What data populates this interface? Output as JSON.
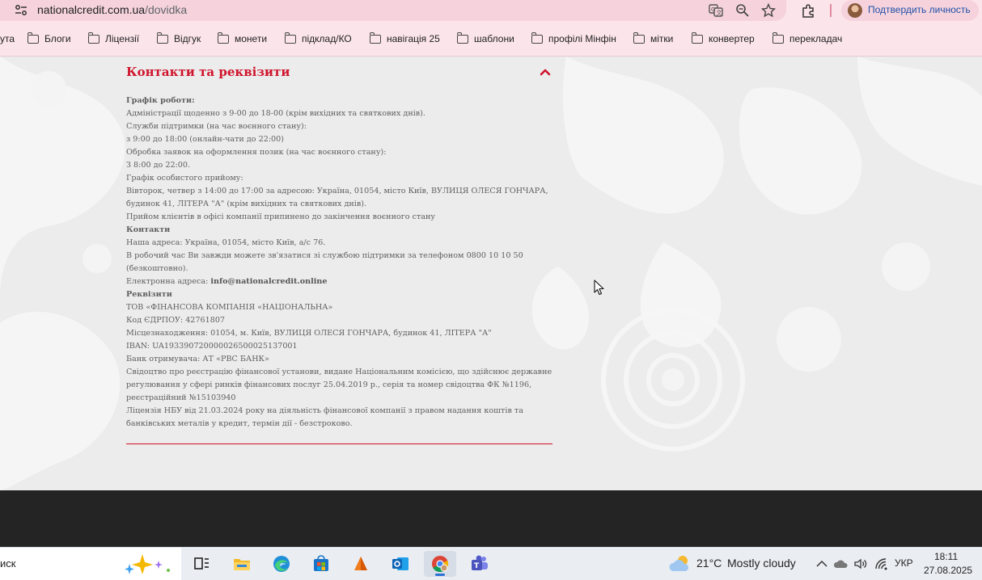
{
  "browser": {
    "url_host": "nationalcredit.com.ua",
    "url_path": "/dovidka",
    "profile_label": "Подтвердить личность",
    "bookmarks": [
      {
        "label": "ута",
        "folder": false
      },
      {
        "label": "Блоги",
        "folder": true
      },
      {
        "label": "Ліцензії",
        "folder": true
      },
      {
        "label": "Відгук",
        "folder": true
      },
      {
        "label": "монети",
        "folder": true
      },
      {
        "label": "підклад/КО",
        "folder": true
      },
      {
        "label": "навігація 25",
        "folder": true
      },
      {
        "label": "шаблони",
        "folder": true
      },
      {
        "label": "профілі Мінфін",
        "folder": true
      },
      {
        "label": "мітки",
        "folder": true
      },
      {
        "label": "конвертер",
        "folder": true
      },
      {
        "label": "перекладач",
        "folder": true
      }
    ]
  },
  "section": {
    "title": "Контакти та реквізити",
    "lines": [
      {
        "text": "Графік роботи:",
        "bold": true
      },
      {
        "text": "Адміністрації щоденно з 9-00 до 18-00 (крім вихідних та святкових днів).",
        "bold": false
      },
      {
        "text": "Служби підтримки (на час воєнного стану):",
        "bold": false
      },
      {
        "text": "з 9:00 до 18:00 (онлайн-чати до 22:00)",
        "bold": false
      },
      {
        "text": "Обробка заявок на оформлення позик (на час воєнного стану):",
        "bold": false
      },
      {
        "text": "З 8:00 до 22:00.",
        "bold": false
      },
      {
        "text": "Графік особистого прийому:",
        "bold": false
      },
      {
        "text": "Вівторок, четвер з 14:00 до 17:00 за адресою: Україна, 01054, місто Київ, ВУЛИЦЯ ОЛЕСЯ ГОНЧАРА,",
        "bold": false
      },
      {
        "text": "будинок 41, ЛІТЕРА \"А\" (крім вихідних та святкових днів).",
        "bold": false
      },
      {
        "text": "Прийом клієнтів в офісі компанії припинено до закінчення воєнного стану",
        "bold": false
      },
      {
        "text": "Контакти",
        "bold": true
      },
      {
        "text": "Наша адреса: Україна, 01054, місто Київ, а/с 76.",
        "bold": false
      },
      {
        "text": "В робочий час Ви завжди можете зв'язатися зі службою підтримки за телефоном 0800 10 10 50",
        "bold": false
      },
      {
        "text": "(безкоштовно).",
        "bold": false
      }
    ],
    "email_label": "Електронна адреса: ",
    "email": "info@nationalcredit.online",
    "lines2": [
      {
        "text": "Реквізити",
        "bold": true
      },
      {
        "text": "ТОВ «ФІНАНСОВА КОМПАНІЯ «НАЦІОНАЛЬНА»",
        "bold": false
      },
      {
        "text": "Код ЄДРПОУ: 42761807",
        "bold": false
      },
      {
        "text": "Місцезнаходження: 01054, м. Київ, ВУЛИЦЯ ОЛЕСЯ ГОНЧАРА, будинок 41, ЛІТЕРА \"А\"",
        "bold": false
      },
      {
        "text": "IBAN: UA193390720000026500025137001",
        "bold": false
      },
      {
        "text": "Банк отримувача: АТ «РВС БАНК»",
        "bold": false
      },
      {
        "text": "Свідоцтво про реєстрацію фінансової установи, видане Національним комісією, що здійснює державне",
        "bold": false
      },
      {
        "text": "регулювання у сфері ринків фінансових послуг 25.04.2019 р., серія та номер свідоцтва ФК №1196,",
        "bold": false
      },
      {
        "text": "реєстраційний №15103940",
        "bold": false
      },
      {
        "text": "Ліцензія НБУ від 21.03.2024 року на діяльність фінансової компанії з правом надання коштів та",
        "bold": false
      },
      {
        "text": "банківських металів у кредит, термін дії - безстроково.",
        "bold": false
      }
    ]
  },
  "taskbar": {
    "search_text": "иск",
    "weather_temp": "21°C",
    "weather_condition": "Mostly cloudy",
    "language": "УКР",
    "time": "18:11",
    "date": "27.08.2025"
  },
  "colors": {
    "accent_red": "#d0142c",
    "browser_bar": "#fce5ea",
    "footer": "#242424"
  }
}
